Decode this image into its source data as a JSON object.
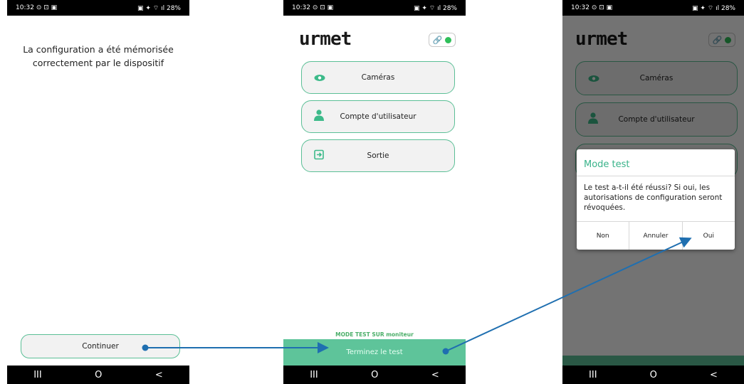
{
  "status_bar": {
    "time": "10:32",
    "left_icons": "⊙ ⊡ ▣",
    "right_icons": "▣ ✦ ⌔ ıl",
    "battery": "28%"
  },
  "screen1": {
    "message_line1": "La configuration a été mémorisée",
    "message_line2": "correctement par le dispositif",
    "continue_button": "Continuer"
  },
  "app": {
    "logo": "urmet",
    "menu": [
      {
        "label": "Caméras",
        "icon": "eye-icon"
      },
      {
        "label": "Compte d'utilisateur",
        "icon": "user-icon"
      },
      {
        "label": "Sortie",
        "icon": "exit-icon"
      }
    ],
    "mode_test_label": "MODE TEST SUR moniteur",
    "finish_button": "Terminez le test",
    "accent_color": "#5ec49a"
  },
  "dialog": {
    "title": "Mode test",
    "body": "Le test a-t-il été réussi? Si oui, les autorisations de configuration seront révoquées.",
    "buttons": [
      "Non",
      "Annuler",
      "Oui"
    ]
  },
  "navbar": {
    "recents": "III",
    "home": "O",
    "back": "<"
  }
}
